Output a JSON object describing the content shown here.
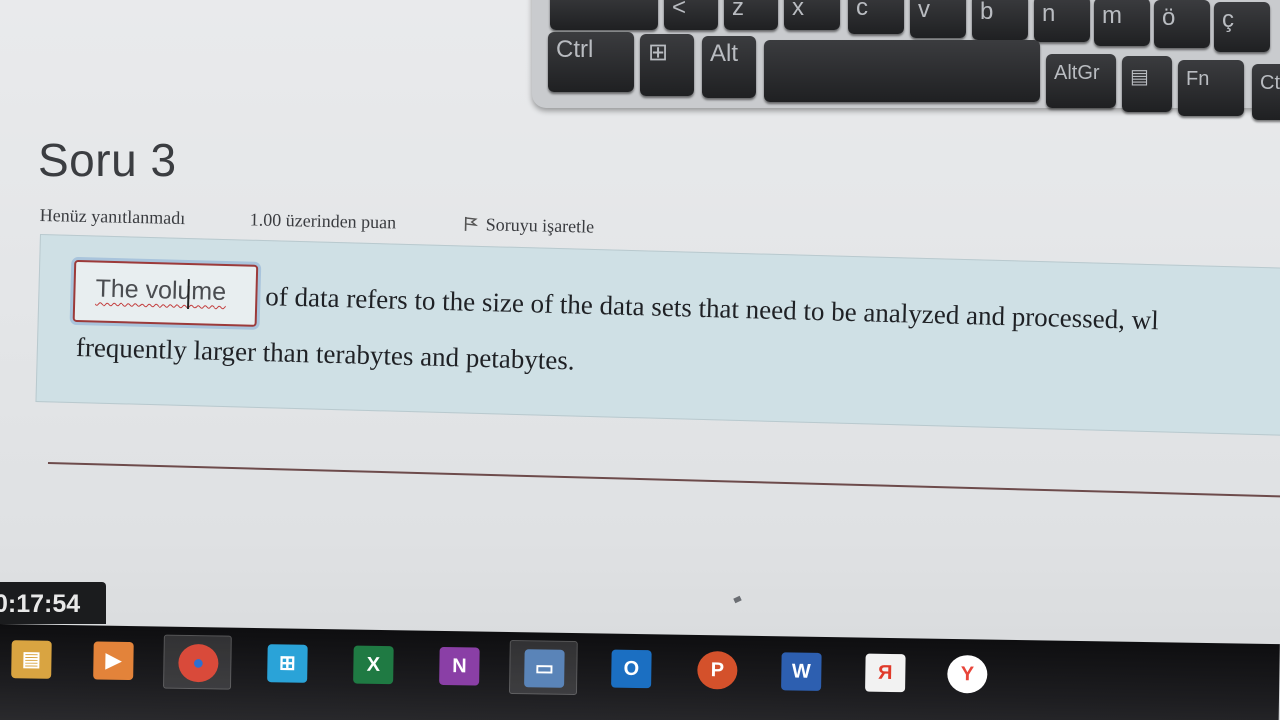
{
  "keyboard": {
    "row1": [
      "<",
      "z",
      "x",
      "c",
      "v",
      "b",
      "n",
      "m",
      "ö",
      "ç"
    ],
    "row2": [
      "Ctrl",
      "⊞",
      "Alt",
      "",
      "AltGr",
      "▤",
      "Fn",
      "Ct"
    ]
  },
  "question": {
    "title": "Soru 3",
    "status": "Henüz yanıtlanmadı",
    "points": "1.00 üzerinden puan",
    "flag_label": "Soruyu işaretle",
    "answer_value": "The volume",
    "text_line1": "of data refers to the size of the data sets that need to be analyzed and processed, wl",
    "text_line2": "frequently larger than terabytes and petabytes."
  },
  "timer": {
    "value": "0:17:54"
  },
  "taskbar": {
    "apps": [
      {
        "icon": "file-explorer-icon",
        "color": "#d9a441",
        "glyph": "▤"
      },
      {
        "icon": "media-player-icon",
        "color": "#e3833a",
        "glyph": "▶"
      },
      {
        "icon": "chrome-icon",
        "color": "#d94a3a",
        "glyph": "●"
      },
      {
        "icon": "store-icon",
        "color": "#2aa3d8",
        "glyph": "⊞"
      },
      {
        "icon": "excel-icon",
        "color": "#1f7a43",
        "glyph": "X"
      },
      {
        "icon": "onenote-icon",
        "color": "#8a3fa6",
        "glyph": "N"
      },
      {
        "icon": "remote-desktop-icon",
        "color": "#5a84b8",
        "glyph": "▭"
      },
      {
        "icon": "outlook-icon",
        "color": "#1b6fc2",
        "glyph": "O"
      },
      {
        "icon": "powerpoint-icon",
        "color": "#d4512b",
        "glyph": "P"
      },
      {
        "icon": "word-icon",
        "color": "#2d5fb0",
        "glyph": "W"
      },
      {
        "icon": "yandex-icon",
        "color": "#e03a2a",
        "glyph": "Я"
      },
      {
        "icon": "yandex-browser-icon",
        "color": "#e8453a",
        "glyph": "Y"
      }
    ]
  }
}
